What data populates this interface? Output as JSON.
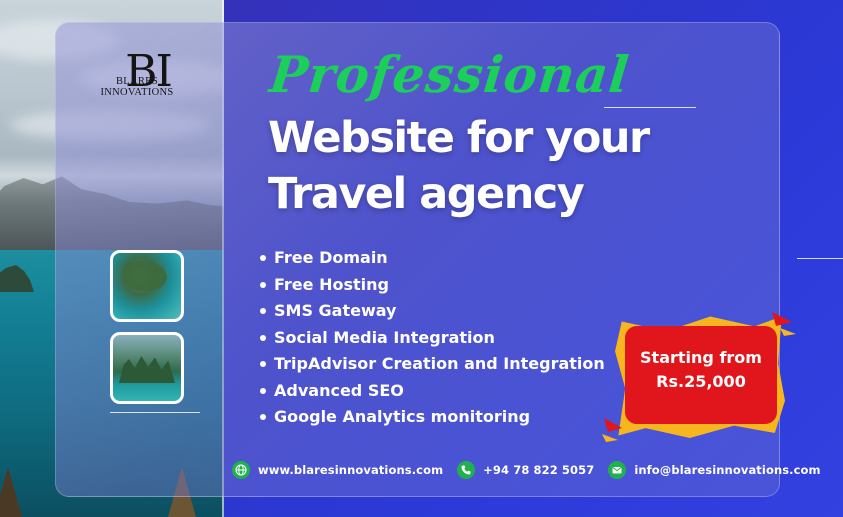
{
  "brand": {
    "logo_letters": "BI",
    "name_line1": "BLARES",
    "name_line2": "INNOVATIONS"
  },
  "headline": {
    "script": "Professional",
    "line1": "Website for your",
    "line2": "Travel agency"
  },
  "features": [
    "Free Domain",
    "Free Hosting",
    "SMS Gateway",
    "Social Media Integration",
    "TripAdvisor Creation and Integration",
    "Advanced SEO",
    "Google Analytics monitoring"
  ],
  "price_badge": {
    "line1": "Starting from",
    "line2": "Rs.25,000"
  },
  "contact": {
    "website": "www.blaresinnovations.com",
    "phone": "+94 78 822 5057",
    "email": "info@blaresinnovations.com"
  },
  "icons": {
    "website": "globe-icon",
    "phone": "phone-icon",
    "email": "mail-icon"
  },
  "colors": {
    "accent_green": "#1ccf5a",
    "badge_red": "#e0161c",
    "badge_yellow": "#f7b51e",
    "background_blue": "#2e35c8"
  }
}
